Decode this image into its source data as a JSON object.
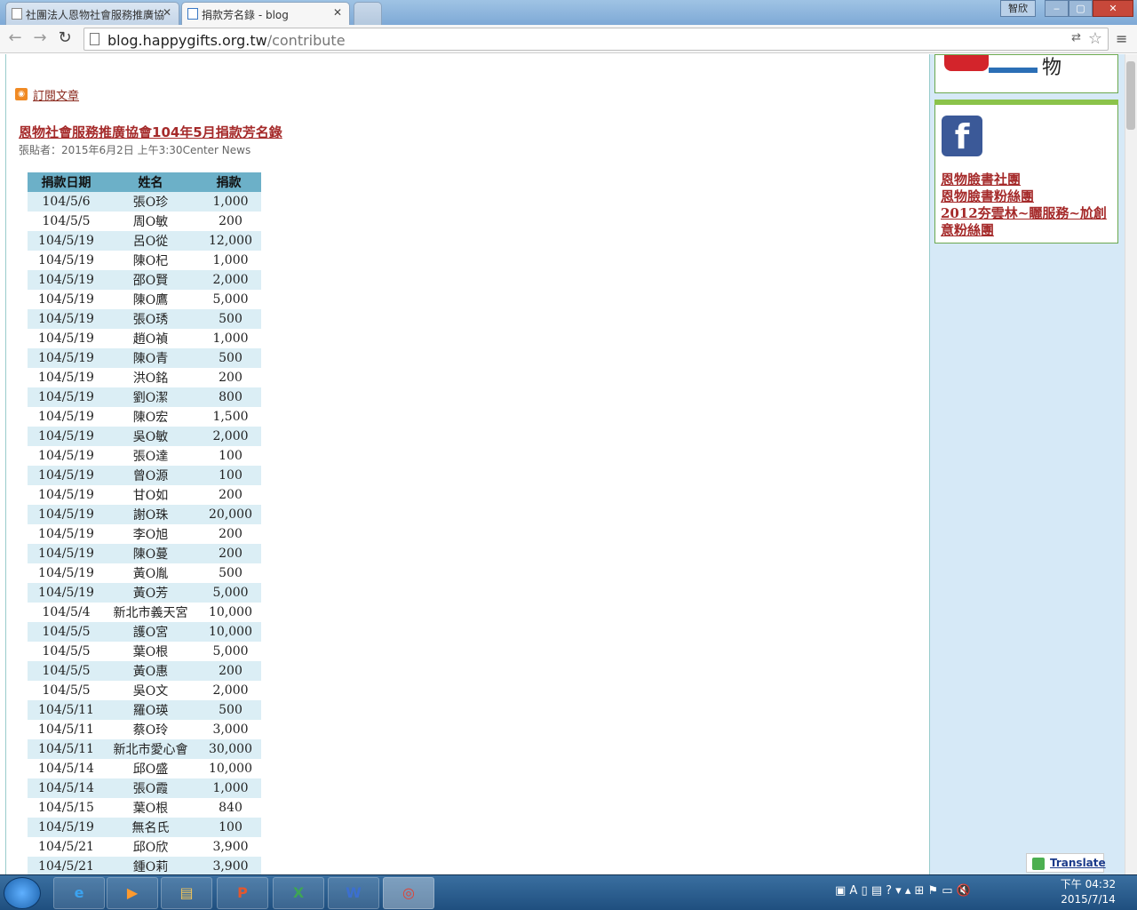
{
  "browser": {
    "tabs": [
      {
        "label": "社團法人恩物社會服務推廣協"
      },
      {
        "label": "捐款芳名錄 - blog"
      }
    ],
    "url_host": "blog.happygifts.org.tw",
    "url_path": "/contribute",
    "window_lang": "智欣"
  },
  "page": {
    "subscribe_label": "訂閱文章",
    "post_title": "恩物社會服務推廣協會104年5月捐款芳名錄",
    "post_meta": "張貼者：2015年6月2日 上午3:30Center News",
    "table": {
      "headers": [
        "捐款日期",
        "姓名",
        "捐款"
      ],
      "rows": [
        [
          "104/5/6",
          "張O珍",
          "1,000"
        ],
        [
          "104/5/5",
          "周O敏",
          "200"
        ],
        [
          "104/5/19",
          "呂O從",
          "12,000"
        ],
        [
          "104/5/19",
          "陳O杞",
          "1,000"
        ],
        [
          "104/5/19",
          "邵O賢",
          "2,000"
        ],
        [
          "104/5/19",
          "陳O鷹",
          "5,000"
        ],
        [
          "104/5/19",
          "張O琇",
          "500"
        ],
        [
          "104/5/19",
          "趙O禎",
          "1,000"
        ],
        [
          "104/5/19",
          "陳O青",
          "500"
        ],
        [
          "104/5/19",
          "洪O銘",
          "200"
        ],
        [
          "104/5/19",
          "劉O潔",
          "800"
        ],
        [
          "104/5/19",
          "陳O宏",
          "1,500"
        ],
        [
          "104/5/19",
          "吳O敏",
          "2,000"
        ],
        [
          "104/5/19",
          "張O達",
          "100"
        ],
        [
          "104/5/19",
          "曾O源",
          "100"
        ],
        [
          "104/5/19",
          "甘O如",
          "200"
        ],
        [
          "104/5/19",
          "謝O珠",
          "20,000"
        ],
        [
          "104/5/19",
          "李O旭",
          "200"
        ],
        [
          "104/5/19",
          "陳O蔓",
          "200"
        ],
        [
          "104/5/19",
          "黃O胤",
          "500"
        ],
        [
          "104/5/19",
          "黃O芳",
          "5,000"
        ],
        [
          "104/5/4",
          "新北市義天宮",
          "10,000"
        ],
        [
          "104/5/5",
          "護O宮",
          "10,000"
        ],
        [
          "104/5/5",
          "葉O根",
          "5,000"
        ],
        [
          "104/5/5",
          "黃O惠",
          "200"
        ],
        [
          "104/5/5",
          "吳O文",
          "2,000"
        ],
        [
          "104/5/11",
          "羅O瑛",
          "500"
        ],
        [
          "104/5/11",
          "蔡O玲",
          "3,000"
        ],
        [
          "104/5/11",
          "新北市愛心會",
          "30,000"
        ],
        [
          "104/5/14",
          "邱O盛",
          "10,000"
        ],
        [
          "104/5/14",
          "張O霞",
          "1,000"
        ],
        [
          "104/5/15",
          "葉O根",
          "840"
        ],
        [
          "104/5/19",
          "無名氏",
          "100"
        ],
        [
          "104/5/21",
          "邱O欣",
          "3,900"
        ],
        [
          "104/5/21",
          "鍾O莉",
          "3,900"
        ]
      ]
    }
  },
  "sidebar": {
    "logo_char": "物",
    "fb_links": [
      "恩物臉書社團",
      "恩物臉書粉絲團",
      "2012夯雲林~矖服務~尬創意粉絲團"
    ],
    "translate_label": "Translate"
  },
  "taskbar": {
    "clock_time": "下午 04:32",
    "clock_date": "2015/7/14",
    "apps": [
      "e",
      "▶",
      "▤",
      "P",
      "X",
      "W",
      "◎"
    ]
  },
  "colors": {
    "header_bg": "#6cb0c8",
    "alt_row": "#dbeef5",
    "link": "#a52a2a",
    "sidebar_bg": "#d6e9f7"
  }
}
